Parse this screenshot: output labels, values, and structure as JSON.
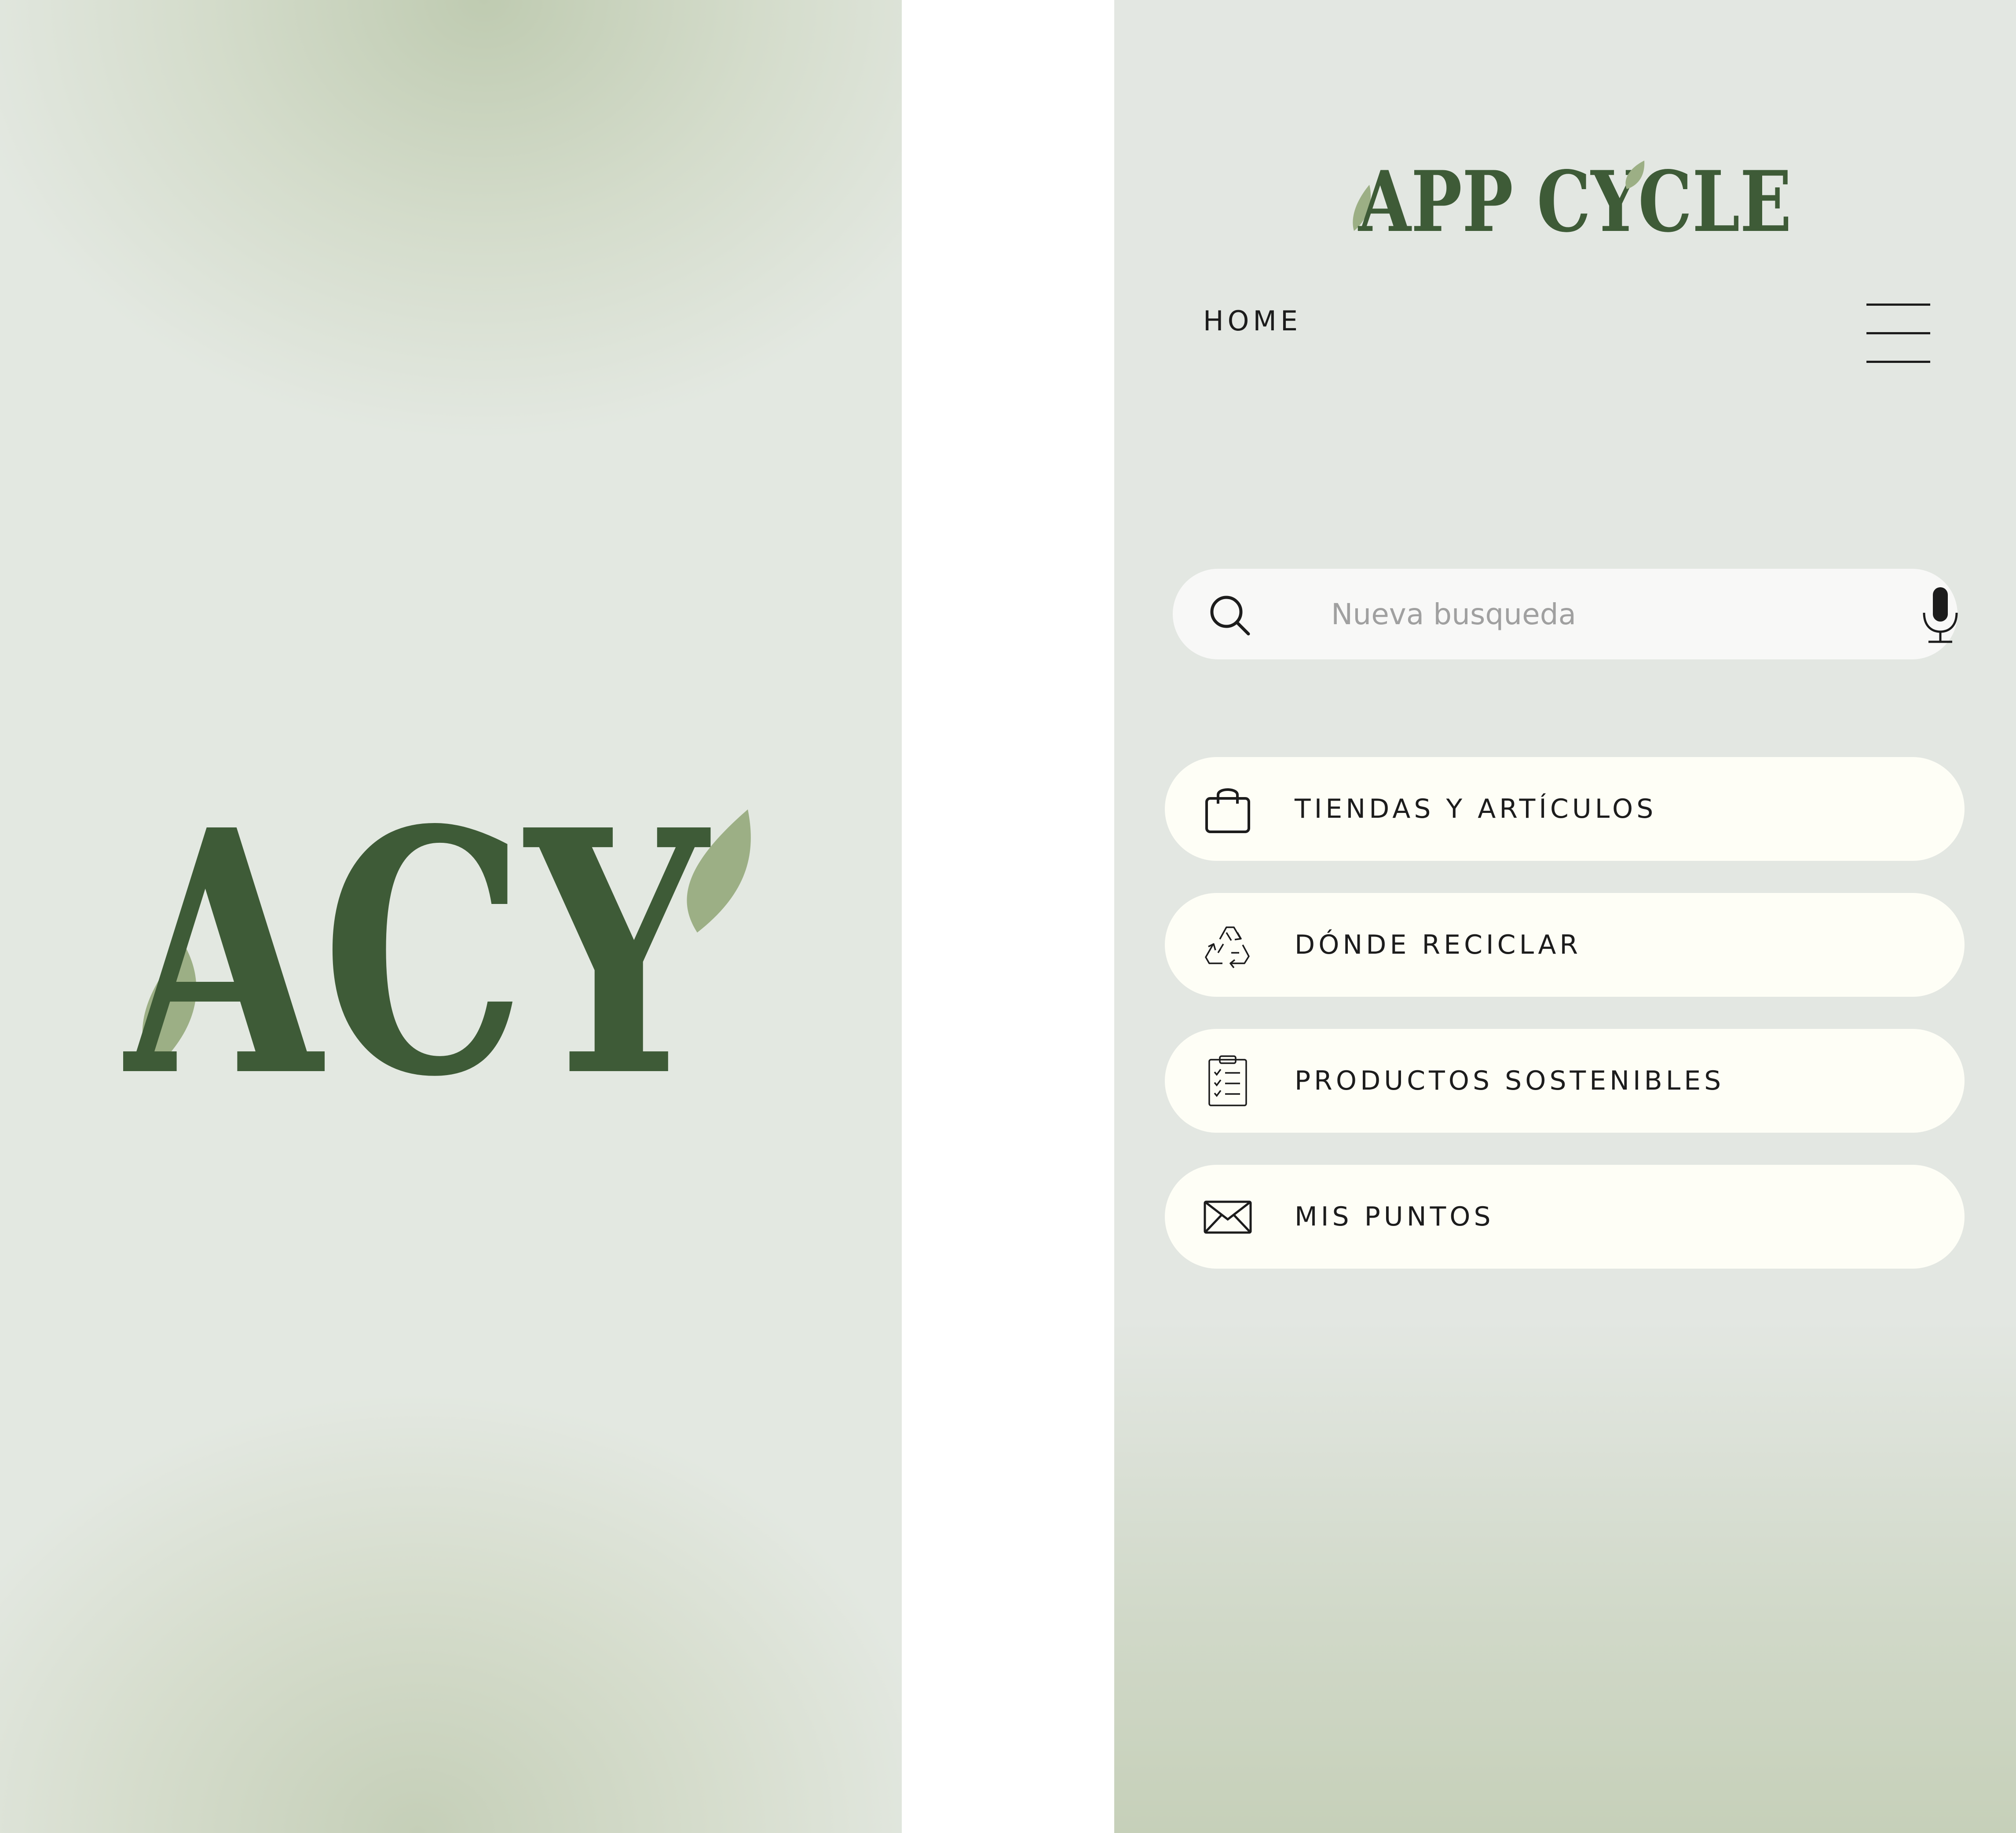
{
  "colors": {
    "brand_dark_green": "#3e5b37",
    "brand_leaf_green": "#9caf85",
    "background": "#e3e7e2",
    "pill": "#fefef6",
    "search_bar": "#f8f8f7",
    "text": "#1c1c1c",
    "placeholder": "#a0a0a0"
  },
  "splash": {
    "logo_text": "ACY"
  },
  "home": {
    "brand_title": "APP CYCLE",
    "page_label": "HOME",
    "menu_icon": "hamburger-menu-icon",
    "search": {
      "placeholder": "Nueva busqueda",
      "value": "",
      "icons": [
        "search-icon",
        "microphone-icon"
      ]
    },
    "menu_items": [
      {
        "label": "TIENDAS Y ARTÍCULOS",
        "icon": "shopping-bag-icon"
      },
      {
        "label": "DÓNDE RECICLAR",
        "icon": "recycle-icon"
      },
      {
        "label": "PRODUCTOS SOSTENIBLES",
        "icon": "clipboard-checklist-icon"
      },
      {
        "label": "MIS PUNTOS",
        "icon": "envelope-icon"
      }
    ]
  }
}
